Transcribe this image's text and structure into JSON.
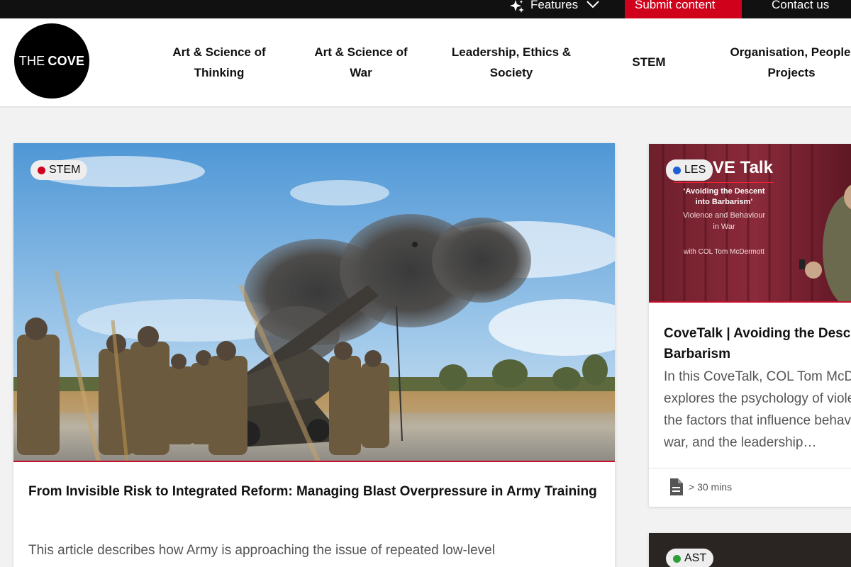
{
  "topbar": {
    "features_label": "Features",
    "submit_label": "Submit content",
    "contact_label": "Contact us"
  },
  "header": {
    "logo_text_1": "THE",
    "logo_text_2": "COVE",
    "nav": [
      {
        "line1": "Art & Science of",
        "line2": "Thinking"
      },
      {
        "line1": "Art & Science of",
        "line2": "War"
      },
      {
        "line1": "Leadership, Ethics &",
        "line2": "Society"
      },
      {
        "line1": "STEM",
        "line2": ""
      },
      {
        "line1": "Organisation, People &",
        "line2": "Projects"
      }
    ]
  },
  "main_card": {
    "tag": "STEM",
    "tag_color": "#d0021b",
    "title": "From Invisible Risk to Integrated Reform: Managing Blast Overpressure in Army Training",
    "excerpt": "This article describes how Army is approaching the issue of repeated low-level"
  },
  "side_card": {
    "tag": "LES",
    "tag_color": "#1f5fd6",
    "image_heading": "VE Talk",
    "image_quote_1": "‘Avoiding the Descent",
    "image_quote_2": "into Barbarism’",
    "image_sub_1": "Violence and Behaviour",
    "image_sub_2": "in War",
    "image_with": "with COL Tom McDermott",
    "title_1": "CoveTalk | Avoiding the Descent into",
    "title_2": "Barbarism",
    "excerpt_lines": [
      "In this CoveTalk, COL Tom McDermott",
      "explores the psychology of violence,",
      "the factors that influence behaviour in",
      "war, and the leadership…"
    ],
    "duration": "> 30 mins"
  },
  "side_card_2": {
    "tag": "AST",
    "tag_color": "#2e9e3a"
  }
}
